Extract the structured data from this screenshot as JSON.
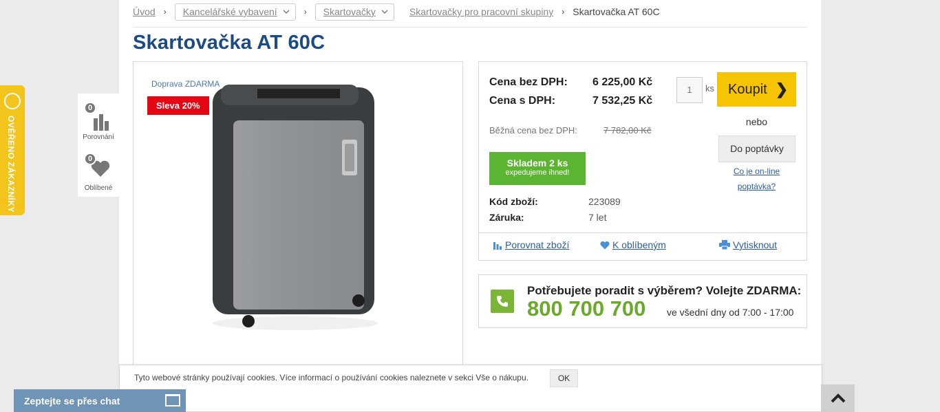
{
  "breadcrumb": {
    "home": "Úvod",
    "cat1": "Kancelářské vybavení",
    "cat2": "Skartovačky",
    "cat3": "Skartovačky pro pracovní skupiny",
    "current": "Skartovačka AT 60C"
  },
  "product": {
    "title": "Skartovačka AT 60C",
    "shipping": "Doprava ZDARMA",
    "discount": "Sleva 20%",
    "price_no_vat_label": "Cena bez DPH:",
    "price_no_vat": "6 225,00 Kč",
    "price_vat_label": "Cena s DPH:",
    "price_vat": "7 532,25 Kč",
    "old_price_label": "Běžná cena bez DPH:",
    "old_price": "7 782,00 Kč",
    "stock_title": "Skladem 2 ks",
    "stock_sub": "expedujeme ihned!",
    "code_label": "Kód zboží:",
    "code": "223089",
    "warranty_label": "Záruka:",
    "warranty": "7 let"
  },
  "purchase": {
    "qty": "1",
    "unit": "ks",
    "buy_label": "Koupit",
    "or": "nebo",
    "inquiry_label": "Do poptávky",
    "online_line1": "Co je on-line",
    "online_line2": "poptávka?"
  },
  "actions": {
    "compare": "Porovnat zboží",
    "favorite": "K oblíbeným",
    "print": "Vytisknout"
  },
  "contact": {
    "heading": "Potřebujete poradit s výběrem? Volejte ZDARMA:",
    "phone": "800 700 700",
    "hours": "ve všední dny od 7:00 - 17:00"
  },
  "widgets": {
    "compare_count": "0",
    "compare_label": "Porovnání",
    "fav_count": "0",
    "fav_label": "Oblíbené",
    "verified": "OVĚŘENO ZÁKAZNÍKY"
  },
  "cookie": {
    "message": "Tyto webové stránky používají cookies. Více informací o používání cookies naleznete v sekci Vše o nákupu.",
    "ok": "OK"
  },
  "chat": {
    "label": "Zeptejte se přes chat"
  },
  "colors": {
    "title": "#1a4b86",
    "buy": "#f6c400",
    "stock": "#5bb532",
    "discount": "#e30613",
    "phone": "#6aa92a",
    "link": "#2a5da6"
  }
}
